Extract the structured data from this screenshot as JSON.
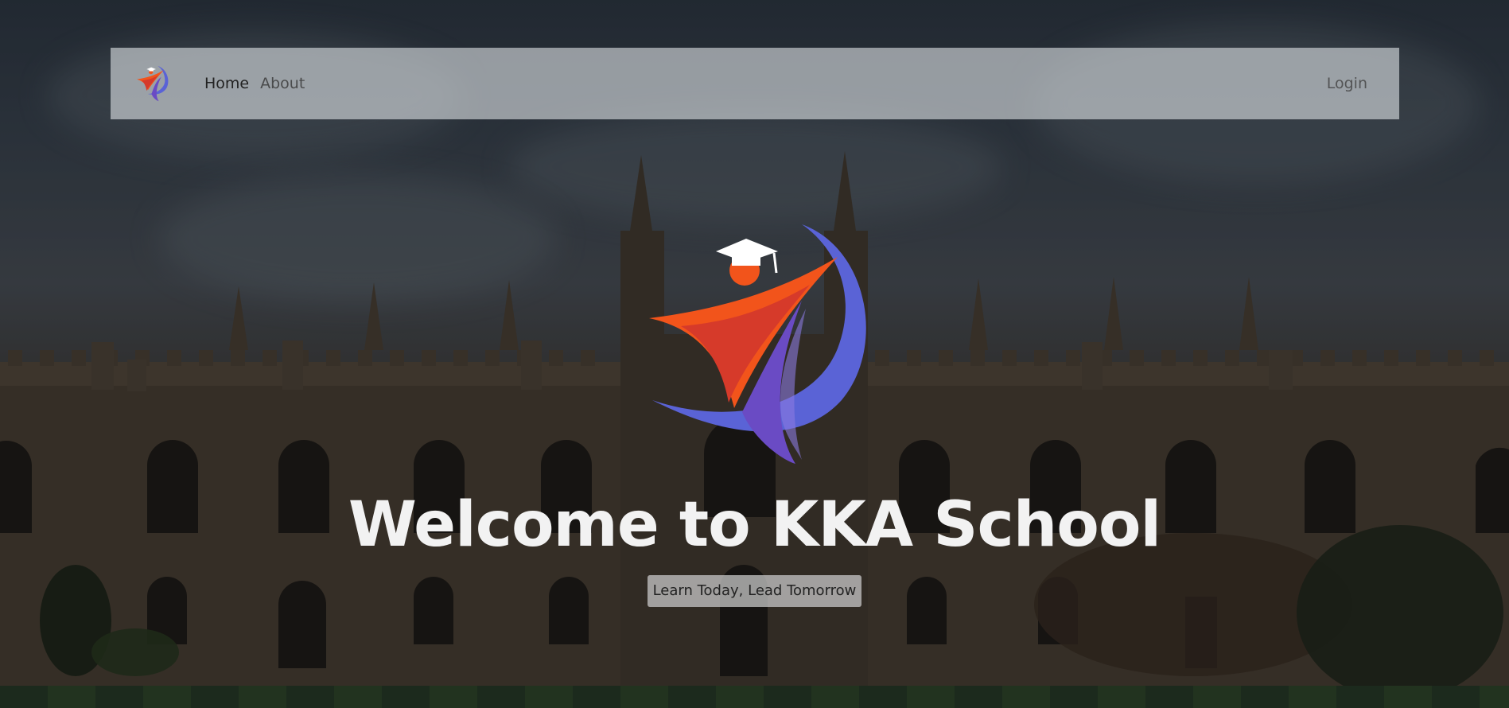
{
  "navbar": {
    "logo_name": "kka-school-logo",
    "links": [
      {
        "label": "Home",
        "active": true
      },
      {
        "label": "About",
        "active": false
      }
    ],
    "login_label": "Login"
  },
  "hero": {
    "title": "Welcome to KKA School",
    "tagline": "Learn Today, Lead Tomorrow",
    "logo_name": "kka-school-emblem"
  },
  "colors": {
    "logo_orange": "#f2541b",
    "logo_red": "#d63a2a",
    "logo_blue": "#5a63d6",
    "logo_purple": "#6a4bc4",
    "title_text": "#f2f2f2"
  }
}
